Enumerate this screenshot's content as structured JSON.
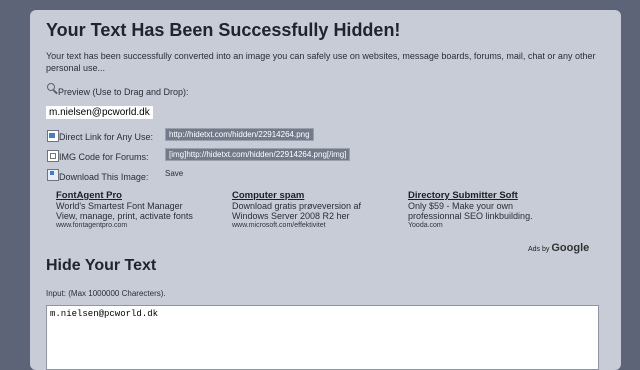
{
  "page": {
    "title": "Your Text Has Been Successfully Hidden!",
    "intro": "Your text has been successfully converted into an image you can safely use on websites, message boards, forums, mail, chat or any other personal use..."
  },
  "preview": {
    "label": "Preview (Use to Drag and Drop):",
    "value": "m.nielsen@pcworld.dk"
  },
  "direct_link": {
    "label": "Direct Link for Any Use:",
    "value": "http://hidetxt.com/hidden/22914264.png"
  },
  "img_code": {
    "label": "IMG Code for Forums:",
    "value": "[img]http://hidetxt.com/hidden/22914264.png[/img]"
  },
  "download": {
    "label": "Download This Image:",
    "save_label": "Save"
  },
  "ads": [
    {
      "title": "FontAgent Pro",
      "line1": "World's Smartest Font Manager",
      "line2": "View, manage, print, activate fonts",
      "url": "www.fontagentpro.com"
    },
    {
      "title": "Computer spam",
      "line1": "Download gratis prøveversion af",
      "line2": "Windows Server 2008 R2 her",
      "url": "www.microsoft.com/effektivitet"
    },
    {
      "title": "Directory Submitter Soft",
      "line1": "Only $59 - Make your own",
      "line2": "professionnal SEO linkbuilding.",
      "url": "Yooda.com"
    }
  ],
  "ads_by": {
    "prefix": "Ads by",
    "brand": "Google"
  },
  "hide_section": {
    "heading": "Hide Your Text",
    "input_label": "Input: (Max 1000000 Charecters).",
    "input_value": "m.nielsen@pcworld.dk"
  },
  "icons": {
    "preview": "magnifier-icon",
    "direct_link": "document-icon",
    "img_code": "image-document-icon",
    "download": "save-icon"
  }
}
